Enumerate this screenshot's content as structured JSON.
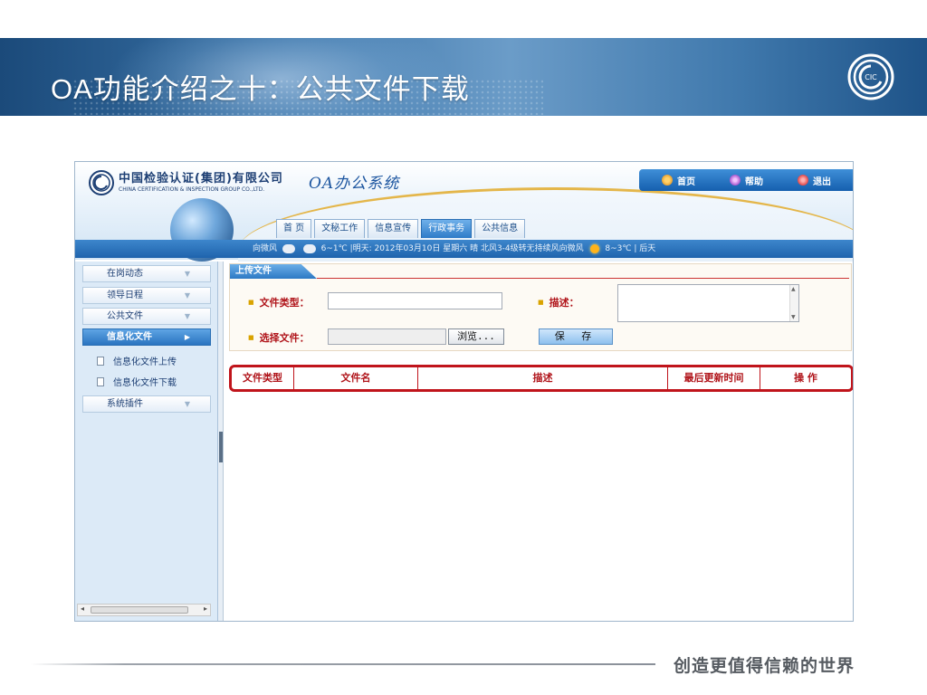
{
  "slide": {
    "title": "OA功能介绍之十：公共文件下载",
    "tagline": "创造更值得信赖的世界",
    "logo_text": "CIC"
  },
  "app": {
    "company_cn": "中国检验认证(集团)有限公司",
    "company_en": "CHINA CERTIFICATION & INSPECTION GROUP CO.,LTD.",
    "oa_title": "OA办公系统",
    "toplinks": [
      {
        "label": "首页",
        "icon": "home-icon"
      },
      {
        "label": "帮助",
        "icon": "help-icon"
      },
      {
        "label": "退出",
        "icon": "exit-icon"
      }
    ],
    "nav_tabs": [
      "首 页",
      "文秘工作",
      "信息宣传",
      "行政事务",
      "公共信息"
    ],
    "active_nav_tab": "行政事务",
    "weather": {
      "today": "向微风",
      "today_temp": "6~1℃",
      "tomorrow": "|明天: 2012年03月10日 星期六 晴 北风3-4级转无持续风向微风",
      "tomorrow_temp": "8~3℃",
      "after": "| 后天"
    },
    "sidebar": {
      "items": [
        "在岗动态",
        "领导日程",
        "公共文件",
        "信息化文件",
        "系统插件"
      ],
      "active": "信息化文件",
      "subitems": [
        "信息化文件上传",
        "信息化文件下载"
      ]
    },
    "upload": {
      "tab_label": "上传文件",
      "file_type_label": "文件类型：",
      "file_type_value": "",
      "description_label": "描述：",
      "description_value": "",
      "choose_file_label": "选择文件：",
      "choose_file_value": "",
      "browse_button": "浏览...",
      "save_button": "保 存"
    },
    "grid": {
      "columns": [
        "文件类型",
        "文件名",
        "描述",
        "最后更新时间",
        "操 作"
      ]
    }
  }
}
